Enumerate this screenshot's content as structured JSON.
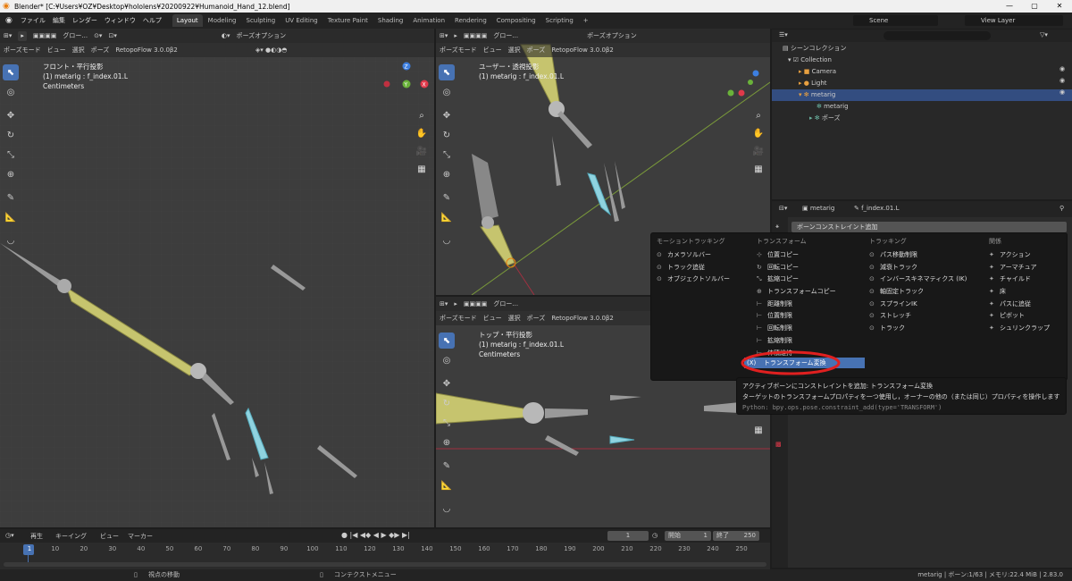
{
  "window": {
    "title": "Blender* [C:¥Users¥OZ¥Desktop¥hololens¥20200922¥Humanoid_Hand_12.blend]",
    "controls": [
      "—",
      "▢",
      "✕"
    ]
  },
  "menubar": {
    "items": [
      "ファイル",
      "編集",
      "レンダー",
      "ウィンドウ",
      "ヘルプ"
    ],
    "workspaces": [
      "Layout",
      "Modeling",
      "Sculpting",
      "UV Editing",
      "Texture Paint",
      "Shading",
      "Animation",
      "Rendering",
      "Compositing",
      "Scripting"
    ],
    "active_workspace": "Layout",
    "add_tab": "+",
    "scene": "Scene",
    "view_layer": "View Layer"
  },
  "viewport_header": {
    "orientation": "グロー...",
    "pose_options": "ポーズオプション",
    "mode": "ポーズモード",
    "menus": [
      "ビュー",
      "選択",
      "ポーズ"
    ],
    "addon": "RetopoFlow 3.0.0β2"
  },
  "viewport_left": {
    "view_name": "フロント・平行投影",
    "object": "(1) metarig : f_index.01.L",
    "units": "Centimeters"
  },
  "viewport_topright": {
    "view_name": "ユーザー・透視投影",
    "object": "(1) metarig : f_index.01.L"
  },
  "viewport_bottomright": {
    "view_name": "トップ・平行投影",
    "object": "(1) metarig : f_index.01.L",
    "units": "Centimeters"
  },
  "gizmo": {
    "z": "Z",
    "y": "Y",
    "x": "X"
  },
  "outliner": {
    "root": "シーンコレクション",
    "rows": [
      {
        "label": "Collection",
        "icon": "collection-icon"
      },
      {
        "label": "Camera",
        "icon": "camera-icon"
      },
      {
        "label": "Light",
        "icon": "light-icon"
      },
      {
        "label": "metarig",
        "icon": "armature-icon",
        "selected": true
      },
      {
        "label": "metarig",
        "icon": "armature-data-icon"
      },
      {
        "label": "ポーズ",
        "icon": "pose-icon"
      }
    ]
  },
  "properties": {
    "object": "metarig",
    "bone": "f_index.01.L",
    "add_constraint": "ボーンコンストレイント追加"
  },
  "constraint_menu": {
    "columns": [
      {
        "header": "モーショントラッキング",
        "items": [
          "カメラソルバー",
          "トラック追従",
          "オブジェクトソルバー"
        ]
      },
      {
        "header": "トランスフォーム",
        "items": [
          "位置コピー",
          "回転コピー",
          "拡縮コピー",
          "トランスフォームコピー",
          "距離制限",
          "位置制限",
          "回転制限",
          "拡縮制限",
          "体積維持",
          "トランスフォーム変換"
        ]
      },
      {
        "header": "トラッキング",
        "items": [
          "パス移動制限",
          "減衰トラック",
          "インバースキネマティクス (IK)",
          "軸固定トラック",
          "スプラインIK",
          "ストレッチ",
          "トラック"
        ]
      },
      {
        "header": "関係",
        "items": [
          "アクション",
          "アーマチュア",
          "チャイルド",
          "床",
          "パスに追従",
          "ピボット",
          "シュリンクラップ"
        ]
      }
    ],
    "highlighted": "トランスフォーム変換"
  },
  "tooltip": {
    "line1": "アクティブボーンにコンストレイントを追加: トランスフォーム変換",
    "line2": "ターゲットのトランスフォームプロパティを一つ使用し，オーナーの他の（または同じ）プロパティを操作します",
    "python": "Python: bpy.ops.pose.constraint_add(type='TRANSFORM')"
  },
  "timeline": {
    "menus": [
      "再生",
      "キーイング",
      "ビュー",
      "マーカー"
    ],
    "current_frame": "1",
    "start_label": "開始",
    "start": "1",
    "end_label": "終了",
    "end": "250",
    "ticks": [
      "1",
      "10",
      "20",
      "30",
      "40",
      "50",
      "60",
      "70",
      "80",
      "90",
      "100",
      "110",
      "120",
      "130",
      "140",
      "150",
      "160",
      "170",
      "180",
      "190",
      "200",
      "210",
      "220",
      "230",
      "240",
      "250"
    ]
  },
  "statusbar": {
    "left": "視点の移動",
    "middle": "コンテクストメニュー",
    "right": "metarig | ボーン:1/63 | メモリ:22.4 MiB | 2.83.0"
  },
  "colors": {
    "accent": "#4772b3",
    "highlight_ring": "#e02020",
    "bone_yellow": "#c6c46e",
    "bone_cyan": "#8fd3e0",
    "x_axis": "#e0394a",
    "y_axis": "#6ab23a",
    "z_axis": "#3d7fe0"
  }
}
